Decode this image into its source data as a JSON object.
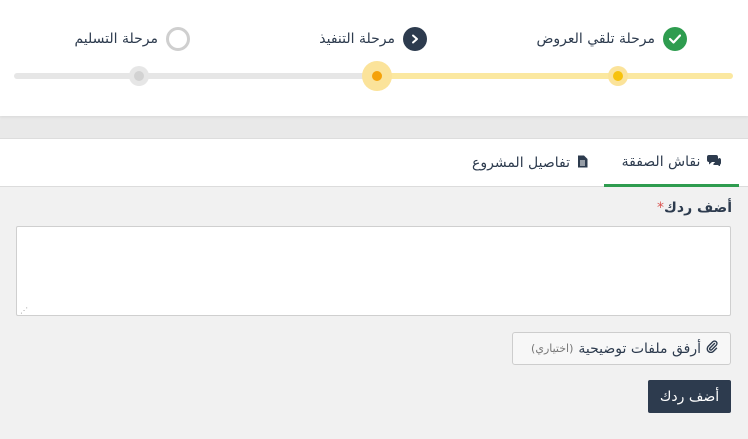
{
  "steps": [
    {
      "label": "مرحلة تلقي العروض",
      "status": "done",
      "icon": "check-icon"
    },
    {
      "label": "مرحلة التنفيذ",
      "status": "current",
      "icon": "chevron-left-icon"
    },
    {
      "label": "مرحلة التسليم",
      "status": "pending",
      "icon": "empty-circle-icon"
    }
  ],
  "colors": {
    "done": "#2e9c4f",
    "current": "#2d3b4e",
    "progress_fill": "#fbe8a0",
    "active_dot": "#f5a20a",
    "tab_underline": "#2e9c4f",
    "required": "#d9534f"
  },
  "tabs": [
    {
      "label": "نقاش الصفقة",
      "icon": "comments-icon",
      "active": true
    },
    {
      "label": "تفاصيل المشروع",
      "icon": "file-icon",
      "active": false
    }
  ],
  "reply": {
    "label": "أضف ردك",
    "required_mark": "*",
    "value": "",
    "placeholder": ""
  },
  "attach": {
    "label": "أرفق ملفات توضيحية",
    "optional": "(اختياري)",
    "icon": "paperclip-icon"
  },
  "submit": {
    "label": "أضف ردك"
  }
}
